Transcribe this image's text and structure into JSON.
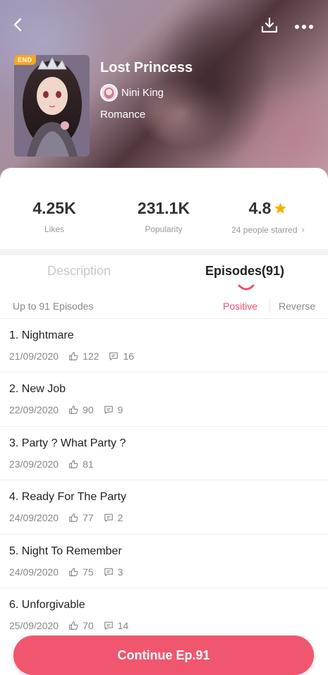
{
  "comic": {
    "title": "Lost Princess",
    "author": "Nini King",
    "genre": "Romance",
    "status_badge": "END"
  },
  "stats": {
    "likes_value": "4.25K",
    "likes_label": "Likes",
    "popularity_value": "231.1K",
    "popularity_label": "Popularity",
    "rating_value": "4.8",
    "rating_label": "24 people starred",
    "rating_chevron": "›"
  },
  "tabs": {
    "description": "Description",
    "episodes": "Episodes(91)"
  },
  "list_header": {
    "count_text": "Up to 91 Episodes",
    "sort_positive": "Positive",
    "sort_reverse": "Reverse"
  },
  "episodes": [
    {
      "title": "1. Nightmare",
      "date": "21/09/2020",
      "likes": "122",
      "comments": "16"
    },
    {
      "title": "2. New Job",
      "date": "22/09/2020",
      "likes": "90",
      "comments": "9"
    },
    {
      "title": "3. Party ? What Party ?",
      "date": "23/09/2020",
      "likes": "81",
      "comments": ""
    },
    {
      "title": "4. Ready For The Party",
      "date": "24/09/2020",
      "likes": "77",
      "comments": "2"
    },
    {
      "title": "5. Night To Remember",
      "date": "24/09/2020",
      "likes": "75",
      "comments": "3"
    },
    {
      "title": "6. Unforgivable",
      "date": "25/09/2020",
      "likes": "70",
      "comments": "14"
    }
  ],
  "continue_label": "Continue Ep.91",
  "icons": {
    "back": "chevron-left-icon",
    "download": "download-icon",
    "more": "more-dots-icon",
    "star": "star-icon",
    "like": "thumbs-up-icon",
    "comment": "comment-icon"
  },
  "colors": {
    "accent": "#f0566e",
    "accent_text": "#ef4d6c",
    "star": "#f5b400",
    "badge": "#f5a623"
  }
}
